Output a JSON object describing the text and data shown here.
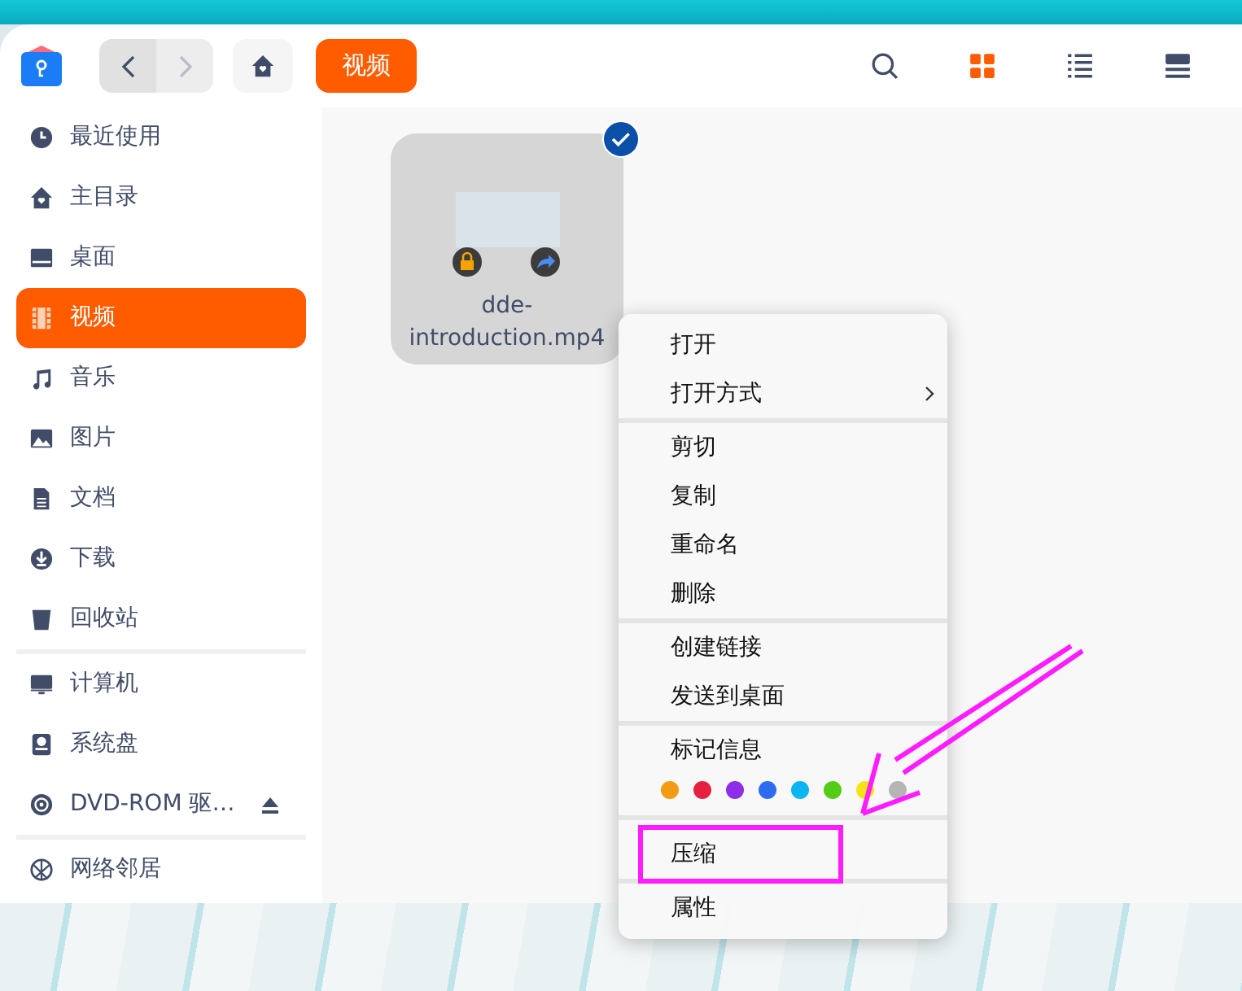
{
  "toolbar": {
    "nav": [
      {
        "kind": "back",
        "disabled": false
      },
      {
        "kind": "forward",
        "disabled": true
      }
    ],
    "breadcrumb": "视频",
    "view_buttons": [
      {
        "kind": "search",
        "selected": false
      },
      {
        "kind": "icons",
        "selected": true
      },
      {
        "kind": "list",
        "selected": false
      },
      {
        "kind": "details",
        "selected": false
      }
    ]
  },
  "sidebar": {
    "groups": [
      [
        {
          "label": "最近使用",
          "kind": "recent",
          "selected": false
        },
        {
          "label": "主目录",
          "kind": "home",
          "selected": false
        },
        {
          "label": "桌面",
          "kind": "desktop",
          "selected": false
        },
        {
          "label": "视频",
          "kind": "video",
          "selected": true
        },
        {
          "label": "音乐",
          "kind": "music",
          "selected": false
        },
        {
          "label": "图片",
          "kind": "pictures",
          "selected": false
        },
        {
          "label": "文档",
          "kind": "documents",
          "selected": false
        },
        {
          "label": "下载",
          "kind": "downloads",
          "selected": false
        },
        {
          "label": "回收站",
          "kind": "trash",
          "selected": false
        }
      ],
      [
        {
          "label": "计算机",
          "kind": "computer",
          "selected": false
        },
        {
          "label": "系统盘",
          "kind": "disk",
          "selected": false
        },
        {
          "label": "DVD-ROM 驱…",
          "kind": "dvd",
          "selected": false,
          "eject": true
        }
      ],
      [
        {
          "label": "网络邻居",
          "kind": "network",
          "selected": false
        }
      ]
    ]
  },
  "files": [
    {
      "name": "dde-introduction.mp4",
      "selected": true
    }
  ],
  "context_menu": {
    "sections": [
      [
        {
          "label": "打开",
          "submenu": false
        },
        {
          "label": "打开方式",
          "submenu": true
        }
      ],
      [
        {
          "label": "剪切",
          "submenu": false
        },
        {
          "label": "复制",
          "submenu": false
        },
        {
          "label": "重命名",
          "submenu": false
        },
        {
          "label": "删除",
          "submenu": false
        }
      ],
      [
        {
          "label": "创建链接",
          "submenu": false
        },
        {
          "label": "发送到桌面",
          "submenu": false
        }
      ],
      [
        {
          "label": "标记信息",
          "submenu": false,
          "tags": [
            {
              "color": "#f39c12"
            },
            {
              "color": "#e8203f"
            },
            {
              "color": "#8e2ee8"
            },
            {
              "color": "#2d6cf0"
            },
            {
              "color": "#0bb5f2"
            },
            {
              "color": "#52cc14"
            },
            {
              "color": "#f5e214"
            },
            {
              "color": "#b5b5b5"
            }
          ]
        }
      ],
      [
        {
          "label": "压缩",
          "submenu": false,
          "annotated": true
        }
      ],
      [
        {
          "label": "属性",
          "submenu": false
        }
      ]
    ]
  }
}
